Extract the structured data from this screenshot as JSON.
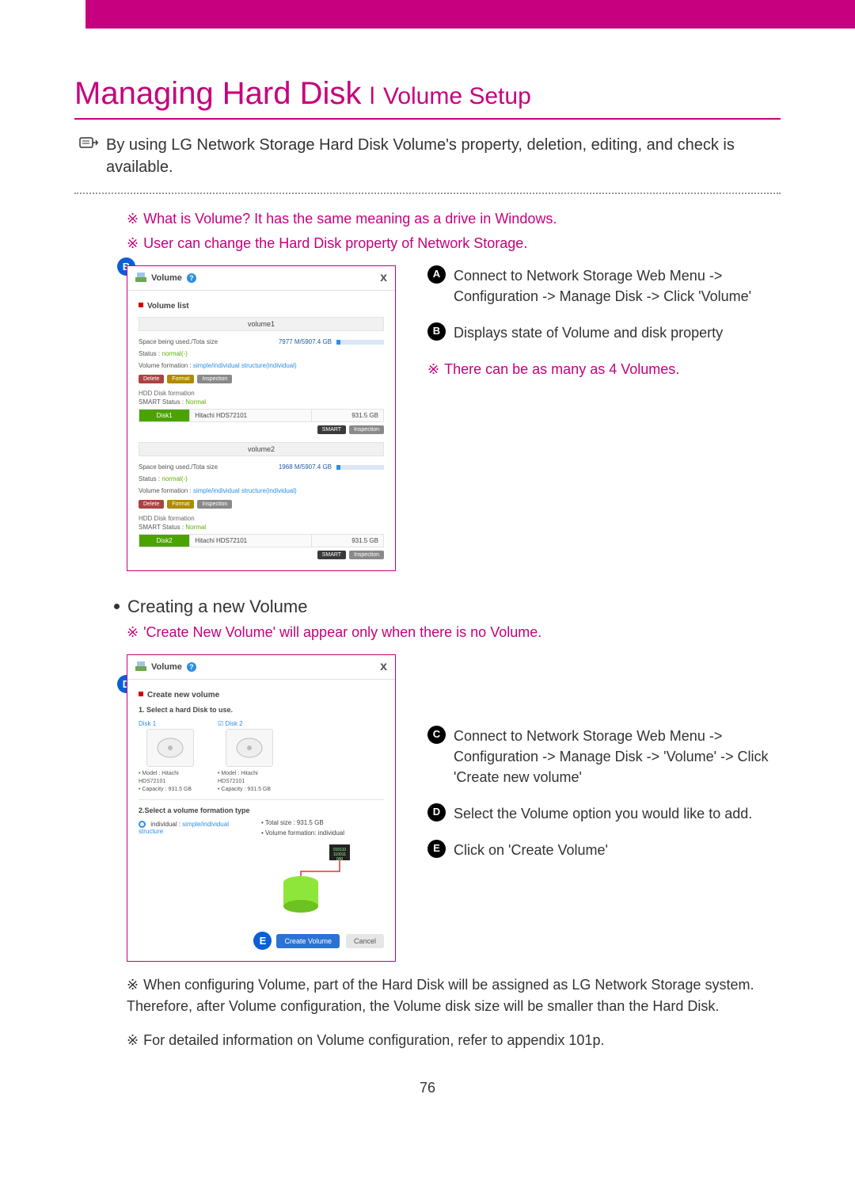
{
  "header": {
    "title_main": "Managing Hard Disk",
    "title_sep": "l",
    "title_sub": "Volume Setup"
  },
  "intro": "By using LG Network Storage Hard Disk Volume's property, deletion, editing, and check is available.",
  "notes": {
    "what_is_volume": "What is Volume? It has the same meaning as a drive in Windows.",
    "user_can_change": "User can change the Hard Disk property of Network Storage."
  },
  "side1": {
    "A": "Connect to Network Storage Web Menu -> Configuration -> Manage Disk -> Click 'Volume'",
    "B": "Displays state of Volume and disk property",
    "note": "There can be as many as 4 Volumes."
  },
  "creating_heading": "Creating a new Volume",
  "creating_note": "'Create New Volume' will appear only when there is no Volume.",
  "side2": {
    "C": "Connect to Network Storage Web Menu -> Configuration -> Manage Disk -> 'Volume' -> Click 'Create new volume'",
    "D": "Select the Volume option you would like to add.",
    "E": "Click on 'Create Volume'"
  },
  "foot_notes": {
    "configuring": "When configuring Volume, part of the Hard Disk will be assigned as LG Network Storage system. Therefore, after Volume configuration, the Volume disk size will be smaller than the Hard Disk.",
    "appendix": "For detailed information on Volume configuration, refer to appendix 101p."
  },
  "page_number": "76",
  "win1": {
    "title": "Volume",
    "section": "Volume list",
    "vol1": {
      "name": "volume1",
      "space_label": "Space being used./Tota  size",
      "space_value": "7977 M/5907.4 GB",
      "status_label": "Status :",
      "status_value": "normal(-)",
      "formation_label": "Volume  formation :",
      "formation_value": "simple/individual structure(individual)",
      "btn_delete": "Delete",
      "btn_format": "Format",
      "btn_inspect": "Inspection",
      "hdd_label": "HDD Disk formation",
      "smart_label": "SMART Status :",
      "smart_value": "Normal",
      "disk_name": "Disk1",
      "disk_model": "Hitachi  HDS72101",
      "disk_size": "931.5 GB",
      "btn_smart": "SMART",
      "btn_inspect2": "Inspection"
    },
    "vol2": {
      "name": "volume2",
      "space_label": "Space being used./Tota  size",
      "space_value": "1968 M/5907.4 GB",
      "status_label": "Status :",
      "status_value": "normal(-)",
      "formation_label": "Volume  formation :",
      "formation_value": "simple/individual structure(individual)",
      "btn_delete": "Delete",
      "btn_format": "Format",
      "btn_inspect": "Inspection",
      "hdd_label": "HDD Disk formation",
      "smart_label": "SMART Status :",
      "smart_value": "Normal",
      "disk_name": "Disk2",
      "disk_model": "Hitachi  HDS72101",
      "disk_size": "931.5 GB",
      "btn_smart": "SMART",
      "btn_inspect2": "Inspection"
    }
  },
  "win2": {
    "title": "Volume",
    "section": "Create new volume",
    "step1": "1. Select a hard Disk to use.",
    "disk1": {
      "label": "Disk 1",
      "model": "• Model : Hitachi HDS72101",
      "cap": "• Capacity : 931.5 GB"
    },
    "disk2": {
      "label": "Disk 2",
      "model": "• Model : Hitachi HDS72101",
      "cap": "• Capacity : 931.5 GB"
    },
    "step2": "2.Select a volume formation type",
    "opt_label": "individual :",
    "opt_desc": "simple/individual structure",
    "total_size": "• Total size : 931.5 GB",
    "vol_formation": "• Volume formation: individual",
    "btn_create": "Create Volume",
    "btn_cancel": "Cancel"
  }
}
